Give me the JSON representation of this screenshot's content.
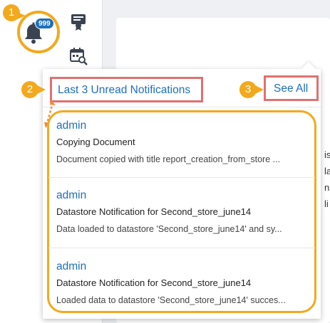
{
  "bell": {
    "count": "999",
    "icon": "bell-icon"
  },
  "rail": {
    "icons": [
      "certificate-icon",
      "calendar-search-icon"
    ]
  },
  "markers": [
    "1",
    "2",
    "3"
  ],
  "panel": {
    "header_title": "Last 3 Unread Notifications",
    "see_all": "See All",
    "items": [
      {
        "user": "admin",
        "title": "Copying Document",
        "description": "Document copied with title report_creation_from_store ..."
      },
      {
        "user": "admin",
        "title": "Datastore Notification for Second_store_june14",
        "description": "Data loaded to datastore 'Second_store_june14' and sy..."
      },
      {
        "user": "admin",
        "title": "Datastore Notification for Second_store_june14",
        "description": "Loaded data to datastore 'Second_store_june14' succes..."
      }
    ]
  },
  "background_text": [
    "is",
    "la",
    "na",
    "li"
  ],
  "colors": {
    "accent": "#1e6fbd",
    "highlight_orange": "#f2a91e",
    "highlight_red": "#e07070"
  }
}
